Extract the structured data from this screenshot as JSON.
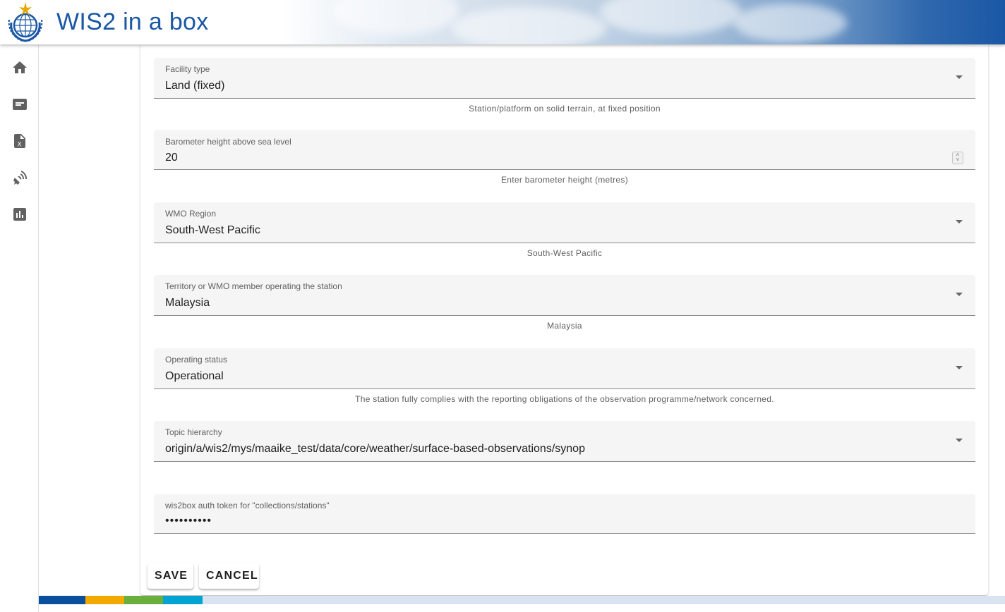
{
  "app": {
    "title": "WIS2 in a box",
    "brand_color": "#1a57a5"
  },
  "sidebar": {
    "items": [
      {
        "name": "home",
        "icon": "home-icon"
      },
      {
        "name": "messages",
        "icon": "message-icon"
      },
      {
        "name": "csv-file",
        "icon": "csv-file-icon"
      },
      {
        "name": "stations",
        "icon": "satellite-antenna-icon"
      },
      {
        "name": "monitoring",
        "icon": "bar-chart-icon"
      }
    ]
  },
  "form": {
    "facility_type": {
      "label": "Facility type",
      "value": "Land (fixed)",
      "hint": "Station/platform on solid terrain, at fixed position"
    },
    "barometer_height": {
      "label": "Barometer height above sea level",
      "value": "20",
      "hint": "Enter barometer height (metres)"
    },
    "wmo_region": {
      "label": "WMO Region",
      "value": "South-West Pacific",
      "hint": "South-West Pacific"
    },
    "territory": {
      "label": "Territory or WMO member operating the station",
      "value": "Malaysia",
      "hint": "Malaysia"
    },
    "operating_status": {
      "label": "Operating status",
      "value": "Operational",
      "hint": "The station fully complies with the reporting obligations of the observation programme/network concerned."
    },
    "topic_hierarchy": {
      "label": "Topic hierarchy",
      "value": "origin/a/wis2/mys/maaike_test/data/core/weather/surface-based-observations/synop"
    },
    "auth_token": {
      "label": "wis2box auth token for \"collections/stations\"",
      "masked_value": "••••••••••"
    }
  },
  "actions": {
    "save_label": "SAVE",
    "cancel_label": "CANCEL"
  },
  "footer": {
    "colors": [
      "#0a4f9e",
      "#f2a900",
      "#6aaf3d",
      "#00a3d1",
      "#d9e4f0"
    ]
  }
}
